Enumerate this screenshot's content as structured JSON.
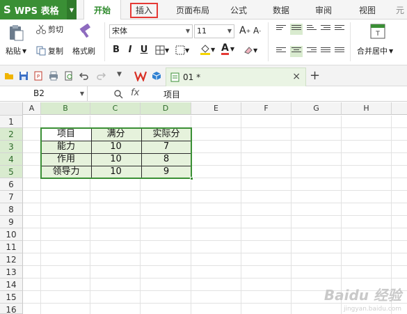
{
  "app": {
    "logo_letter": "S",
    "logo_text": "WPS 表格"
  },
  "menu": {
    "tabs": [
      "开始",
      "插入",
      "页面布局",
      "公式",
      "数据",
      "审阅",
      "视图"
    ],
    "overflow": "元"
  },
  "ribbon": {
    "paste": "粘贴",
    "cut": "剪切",
    "copy": "复制",
    "format_painter": "格式刷",
    "font_name": "宋体",
    "font_size": "11",
    "bold": "B",
    "italic": "I",
    "underline": "U",
    "merge_center": "合并居中"
  },
  "quickbar": {
    "doc_tab": "01 *",
    "close": "×",
    "add": "+"
  },
  "formula_bar": {
    "name_box": "B2",
    "fx": "fx",
    "content": "项目"
  },
  "sheet": {
    "columns": [
      "A",
      "B",
      "C",
      "D",
      "E",
      "F",
      "G",
      "H"
    ],
    "rows": [
      "1",
      "2",
      "3",
      "4",
      "5",
      "6",
      "7",
      "8",
      "9",
      "10",
      "11",
      "12",
      "13",
      "14",
      "15",
      "16"
    ],
    "table": [
      [
        "项目",
        "满分",
        "实际分"
      ],
      [
        "能力",
        "10",
        "7"
      ],
      [
        "作用",
        "10",
        "8"
      ],
      [
        "领导力",
        "10",
        "9"
      ]
    ]
  },
  "watermark": {
    "main": "Baidu 经验",
    "sub": "jingyan.baidu.com"
  },
  "colors": {
    "brand": "#3a8f35",
    "highlight": "#e53935",
    "selection": "#e6f2dc"
  }
}
